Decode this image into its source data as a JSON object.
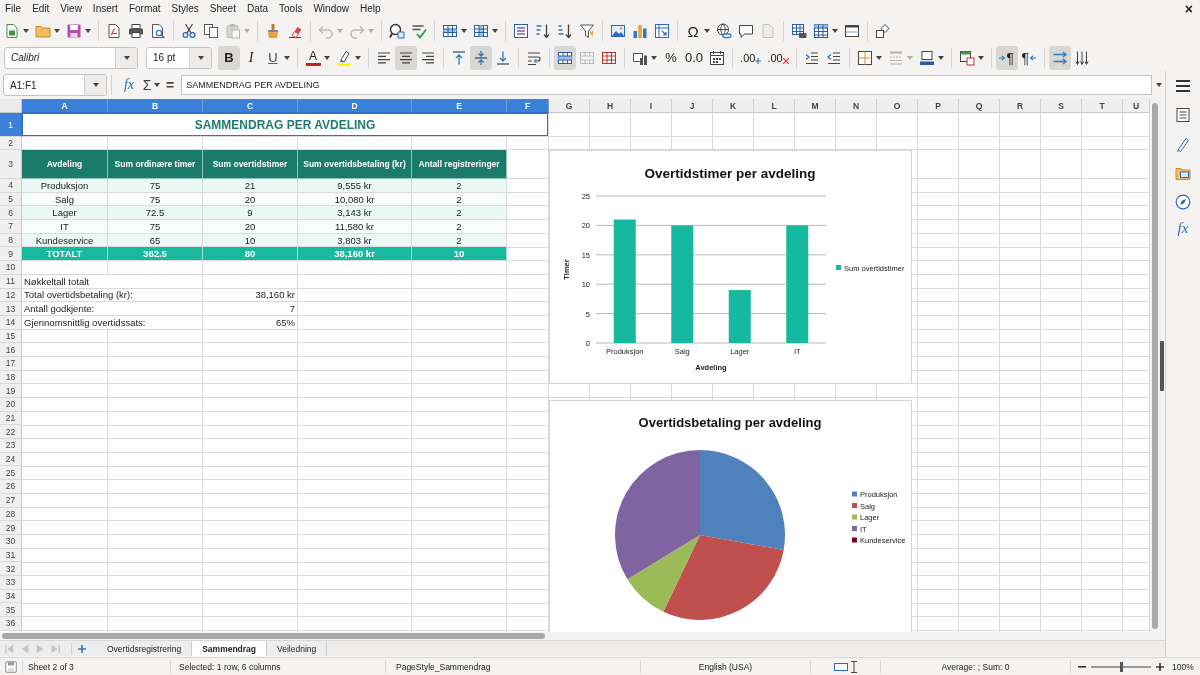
{
  "menu_bar": {
    "items": [
      "File",
      "Edit",
      "View",
      "Insert",
      "Format",
      "Styles",
      "Sheet",
      "Data",
      "Tools",
      "Window",
      "Help"
    ],
    "close_button": "×"
  },
  "standard_toolbar": {
    "paste": {
      "disabled": true
    },
    "undo": {
      "disabled": true
    },
    "redo": {
      "disabled": true
    },
    "special_character": "Ω",
    "header_footer": {
      "disabled": true
    }
  },
  "formatting_toolbar": {
    "font_name": "Calibri",
    "font_size": "16 pt",
    "bold": {
      "label": "B",
      "on": true
    },
    "italic": {
      "label": "I",
      "on": false
    },
    "underline": {
      "label": "U",
      "on": false
    },
    "font_color": {
      "label": "A"
    },
    "horizontal_align": [
      {
        "kind": "left",
        "selected": false
      },
      {
        "kind": "center",
        "selected": true
      },
      {
        "kind": "right",
        "selected": false
      }
    ],
    "vertical_align": [
      {
        "kind": "top",
        "selected": false
      },
      {
        "kind": "center",
        "selected": true
      },
      {
        "kind": "bottom",
        "selected": false
      }
    ],
    "wrap_text": {
      "on": false
    },
    "merge_and_center": {
      "on": true
    },
    "merge_cells": {
      "disabled": true
    },
    "percent": "%",
    "number": "0.0",
    "add_decimal": ".00",
    "delete_decimal": ".00",
    "border_style": {
      "disabled": true
    },
    "paragraph_direction": [
      {
        "kind": "left_to_right",
        "label": "¶",
        "selected": true
      },
      {
        "kind": "right_to_left",
        "label": "¶",
        "selected": false
      }
    ],
    "text_flow": [
      {
        "kind": "horizontal",
        "selected": true
      },
      {
        "kind": "vertical",
        "selected": false
      }
    ]
  },
  "formula_bar": {
    "name_box": "A1:F1",
    "function_wizard": "fx",
    "sum": "Σ",
    "formula": "=",
    "content": "SAMMENDRAG PER AVDELING"
  },
  "sidebar": {
    "functions": "fx"
  },
  "sheet": {
    "columns": [
      {
        "label": "A",
        "selected": true
      },
      {
        "label": "B",
        "selected": true
      },
      {
        "label": "C",
        "selected": true
      },
      {
        "label": "D",
        "selected": true
      },
      {
        "label": "E",
        "selected": true
      },
      {
        "label": "F",
        "selected": true
      },
      {
        "label": "G",
        "selected": false
      },
      {
        "label": "H",
        "selected": false
      },
      {
        "label": "I",
        "selected": false
      },
      {
        "label": "J",
        "selected": false
      },
      {
        "label": "K",
        "selected": false
      },
      {
        "label": "L",
        "selected": false
      },
      {
        "label": "M",
        "selected": false
      },
      {
        "label": "N",
        "selected": false
      },
      {
        "label": "O",
        "selected": false
      },
      {
        "label": "P",
        "selected": false
      },
      {
        "label": "Q",
        "selected": false
      },
      {
        "label": "R",
        "selected": false
      },
      {
        "label": "S",
        "selected": false
      },
      {
        "label": "T",
        "selected": false
      },
      {
        "label": "U",
        "selected": false
      }
    ],
    "rows": [
      {
        "label": "1",
        "selected": true,
        "kind": "title",
        "cells": [
          "SAMMENDRAG PER AVDELING"
        ]
      },
      {
        "label": "2",
        "selected": false,
        "kind": "blank"
      },
      {
        "label": "3",
        "selected": false,
        "kind": "table_header",
        "cells": [
          "Avdeling",
          "Sum ordinære timer",
          "Sum overtidstimer",
          "Sum overtidsbetaling (kr)",
          "Antall registreringer"
        ]
      },
      {
        "label": "4",
        "selected": false,
        "kind": "table_row",
        "cells": [
          "Produksjon",
          "75",
          "21",
          "9,555 kr",
          "2"
        ]
      },
      {
        "label": "5",
        "selected": false,
        "kind": "table_row",
        "cells": [
          "Salg",
          "75",
          "20",
          "10,080 kr",
          "2"
        ]
      },
      {
        "label": "6",
        "selected": false,
        "kind": "table_row",
        "cells": [
          "Lager",
          "72.5",
          "9",
          "3,143 kr",
          "2"
        ]
      },
      {
        "label": "7",
        "selected": false,
        "kind": "table_row",
        "cells": [
          "IT",
          "75",
          "20",
          "11,580 kr",
          "2"
        ]
      },
      {
        "label": "8",
        "selected": false,
        "kind": "table_row",
        "cells": [
          "Kundeservice",
          "65",
          "10",
          "3,803 kr",
          "2"
        ]
      },
      {
        "label": "9",
        "selected": false,
        "kind": "table_total",
        "cells": [
          "TOTALT",
          "362.5",
          "80",
          "38,160 kr",
          "10"
        ]
      },
      {
        "label": "10",
        "selected": false,
        "kind": "blank"
      },
      {
        "label": "11",
        "selected": false,
        "kind": "heading",
        "cells": [
          "Nøkkeltall totalt"
        ]
      },
      {
        "label": "12",
        "selected": false,
        "kind": "key_figure",
        "cells": [
          "Total overtidsbetaling (kr):",
          "38,160 kr"
        ]
      },
      {
        "label": "13",
        "selected": false,
        "kind": "key_figure",
        "cells": [
          "Antall godkjente:",
          "7"
        ]
      },
      {
        "label": "14",
        "selected": false,
        "kind": "key_figure",
        "cells": [
          "Gjennomsnittlig overtidssats:",
          "65%"
        ]
      },
      {
        "label": "15",
        "selected": false,
        "kind": "blank"
      },
      {
        "label": "16",
        "selected": false,
        "kind": "blank"
      },
      {
        "label": "17",
        "selected": false,
        "kind": "blank"
      },
      {
        "label": "18",
        "selected": false,
        "kind": "blank"
      },
      {
        "label": "19",
        "selected": false,
        "kind": "blank"
      },
      {
        "label": "20",
        "selected": false,
        "kind": "blank"
      },
      {
        "label": "21",
        "selected": false,
        "kind": "blank"
      },
      {
        "label": "22",
        "selected": false,
        "kind": "blank"
      },
      {
        "label": "23",
        "selected": false,
        "kind": "blank"
      },
      {
        "label": "24",
        "selected": false,
        "kind": "blank"
      },
      {
        "label": "25",
        "selected": false,
        "kind": "blank"
      },
      {
        "label": "26",
        "selected": false,
        "kind": "blank"
      },
      {
        "label": "27",
        "selected": false,
        "kind": "blank"
      },
      {
        "label": "28",
        "selected": false,
        "kind": "blank"
      },
      {
        "label": "29",
        "selected": false,
        "kind": "blank"
      },
      {
        "label": "30",
        "selected": false,
        "kind": "blank"
      },
      {
        "label": "31",
        "selected": false,
        "kind": "blank"
      },
      {
        "label": "32",
        "selected": false,
        "kind": "blank"
      },
      {
        "label": "33",
        "selected": false,
        "kind": "blank"
      },
      {
        "label": "34",
        "selected": false,
        "kind": "blank"
      },
      {
        "label": "35",
        "selected": false,
        "kind": "blank"
      },
      {
        "label": "36",
        "selected": false,
        "kind": "blank"
      }
    ]
  },
  "charts": [
    {
      "chart_data": {
        "type": "bar",
        "title": "Overtidstimer per avdeling",
        "xlabel": "Avdeling",
        "ylabel": "Timer",
        "categories": [
          "Produksjon",
          "Salg",
          "Lager",
          "IT"
        ],
        "series": [
          {
            "name": "Sum overtidstimer",
            "color": "#17b8a0",
            "values": [
              21,
              20,
              9,
              20
            ]
          }
        ],
        "ylim": [
          0,
          25
        ],
        "yticks": [
          {
            "value": 0,
            "label": "0"
          },
          {
            "value": 5,
            "label": "5"
          },
          {
            "value": 10,
            "label": "10"
          },
          {
            "value": 15,
            "label": "15"
          },
          {
            "value": 20,
            "label": "20"
          },
          {
            "value": 25,
            "label": "25"
          }
        ],
        "grid": true,
        "legend": "right"
      }
    },
    {
      "chart_data": {
        "type": "pie",
        "title": "Overtidsbetaling per avdeling",
        "categories": [
          "Produksjon",
          "Salg",
          "Lager",
          "IT",
          "Kundeservice"
        ],
        "values": [
          27.8,
          29.3,
          9.2,
          33.7,
          0
        ],
        "colors": [
          "#4f81bd",
          "#c0504d",
          "#9bbb59",
          "#8064a2",
          "#7e0021"
        ],
        "legend": "right"
      }
    }
  ],
  "sheet_tabs": {
    "navigation": {
      "disabled": true
    },
    "tabs": [
      {
        "label": "Overtidsregistrering",
        "selected": false
      },
      {
        "label": "Sammendrag",
        "selected": true
      },
      {
        "label": "Veiledning",
        "selected": false
      }
    ]
  },
  "status_bar": {
    "sheet": "Sheet 2 of 3",
    "selection": "Selected: 1 row, 6 columns",
    "page_style": "PageStyle_Sammendrag",
    "language": "English (USA)",
    "statistics": "Average: ; Sum: 0",
    "zoom": {
      "level": 0.5,
      "reading": "100%"
    }
  }
}
